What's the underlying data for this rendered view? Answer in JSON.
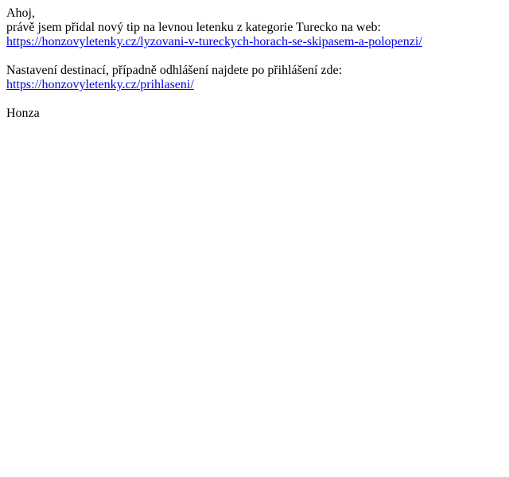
{
  "email": {
    "greeting": "Ahoj,",
    "intro": "právě jsem přidal nový tip na levnou letenku z kategorie Turecko na web:",
    "tip_link": "https://honzovyletenky.cz/lyzovani-v-tureckych-horach-se-skipasem-a-polopenzi/",
    "settings_text": "Nastavení destinací, případně odhlášení najdete po přihlášení zde:",
    "login_link": "https://honzovyletenky.cz/prihlaseni/",
    "signature": "Honza"
  },
  "colors": {
    "text": "#000000",
    "link": "#0000ee",
    "background": "#ffffff"
  }
}
